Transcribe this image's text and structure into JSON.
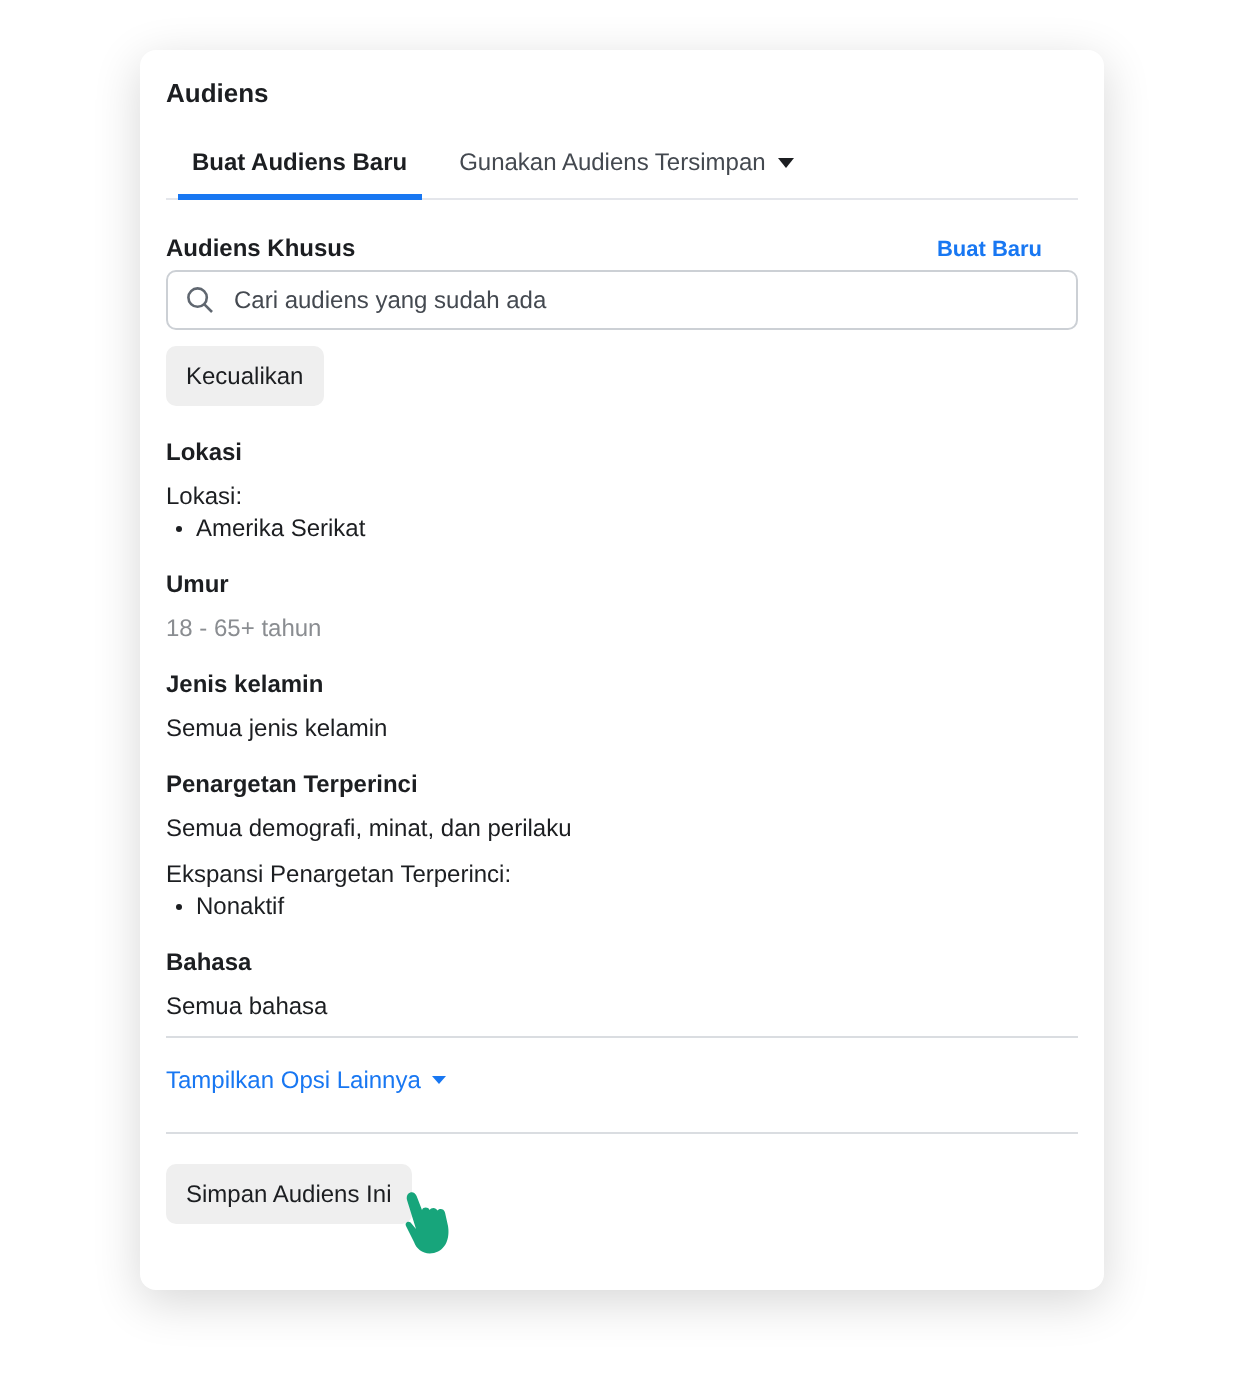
{
  "panel": {
    "title": "Audiens"
  },
  "tabs": [
    {
      "label": "Buat Audiens Baru",
      "selected": true,
      "dropdown": false
    },
    {
      "label": "Gunakan Audiens Tersimpan",
      "selected": false,
      "dropdown": true
    }
  ],
  "custom_audience": {
    "label": "Audiens Khusus",
    "link": "Buat Baru",
    "search": {
      "placeholder": "Cari audiens yang sudah ada"
    },
    "button": "Kecualikan"
  },
  "sections": [
    {
      "title": "Lokasi",
      "lines": [
        {
          "kind": "text",
          "text": "Lokasi:"
        },
        {
          "kind": "bullet",
          "text": "Amerika Serikat"
        }
      ]
    },
    {
      "title": "Umur",
      "lines": [
        {
          "kind": "muted",
          "text": "18 - 65+ tahun"
        }
      ]
    },
    {
      "title": "Jenis kelamin",
      "lines": [
        {
          "kind": "text",
          "text": "Semua jenis kelamin"
        }
      ]
    },
    {
      "title": "Penargetan Terperinci",
      "lines": [
        {
          "kind": "text",
          "text": "Semua demografi, minat, dan perilaku"
        },
        {
          "kind": "text",
          "text": "Ekspansi Penargetan Terperinci:"
        },
        {
          "kind": "bullet",
          "text": "Nonaktif"
        }
      ]
    },
    {
      "title": "Bahasa",
      "lines": [
        {
          "kind": "text",
          "text": "Semua bahasa"
        }
      ]
    }
  ],
  "more_options": "Tampilkan Opsi Lainnya",
  "save_button": "Simpan Audiens Ini"
}
